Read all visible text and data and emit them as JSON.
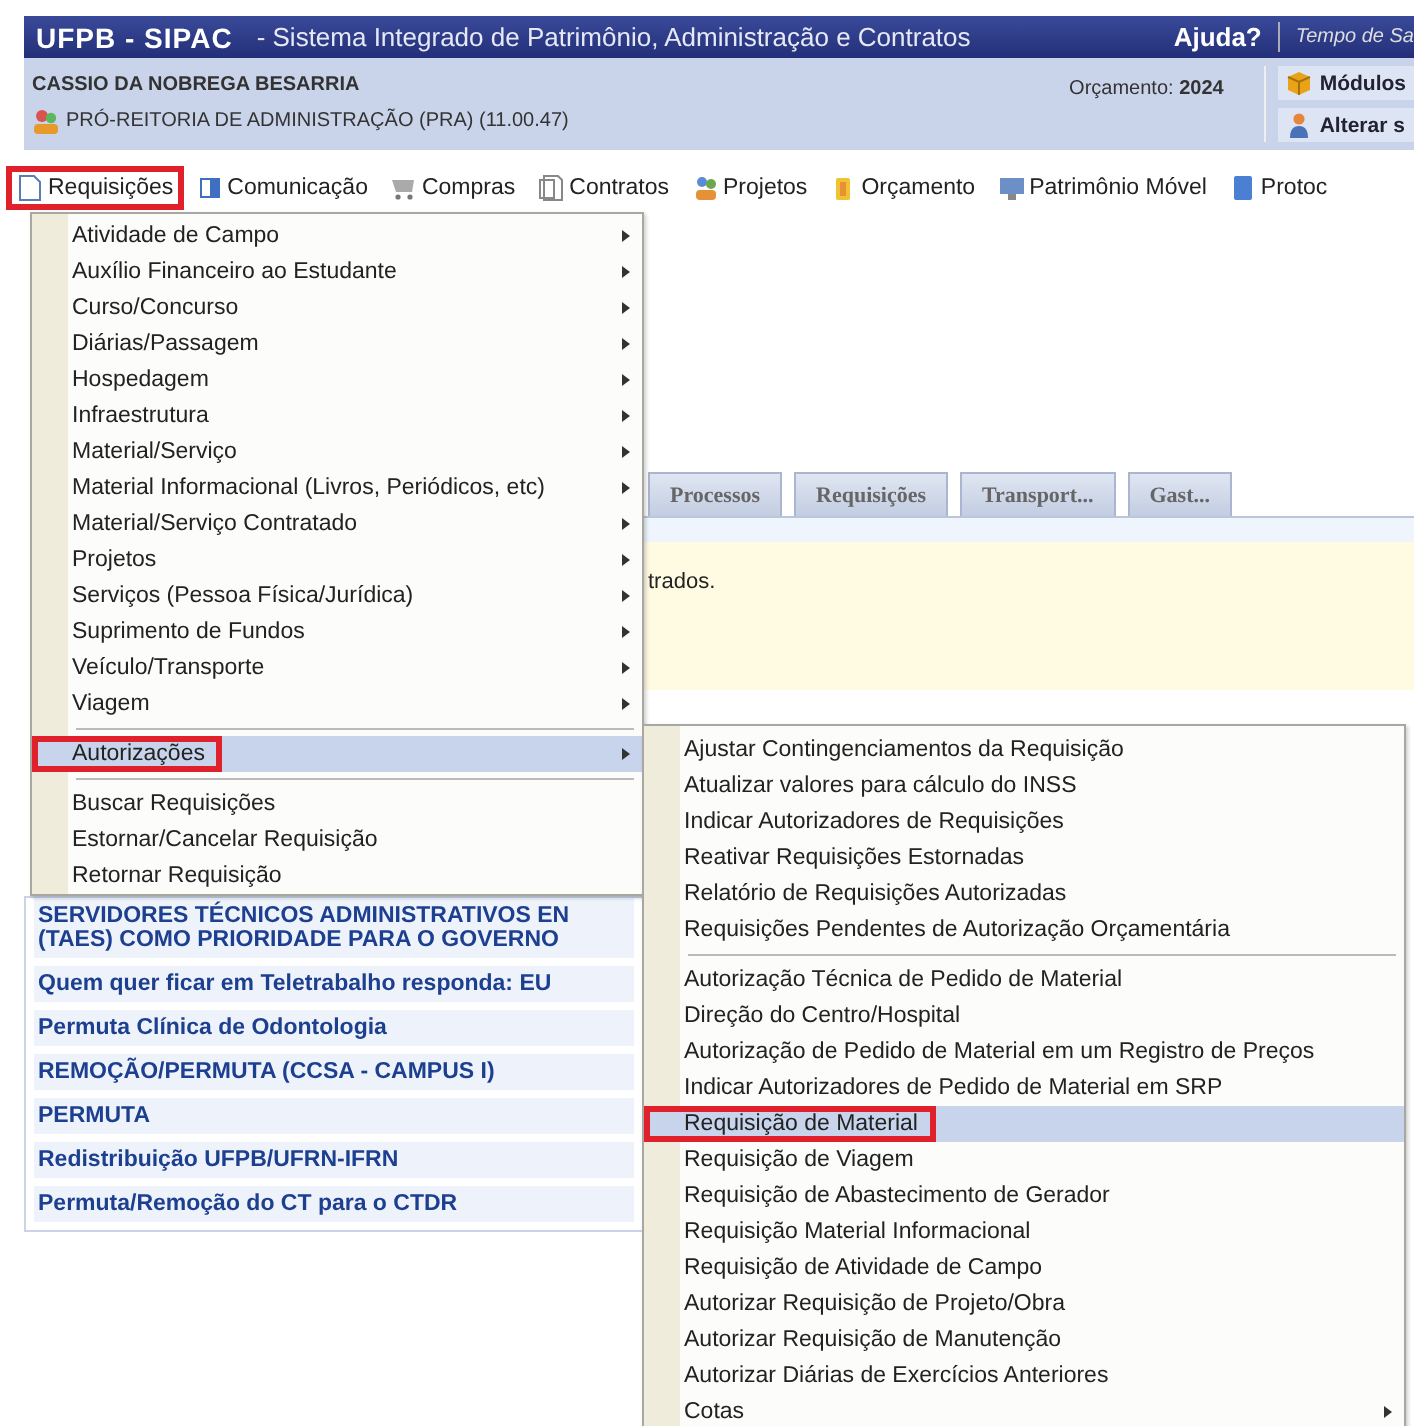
{
  "header": {
    "system": "UFPB - SIPAC",
    "title": "- Sistema Integrado de Patrimônio, Administração e Contratos",
    "help": "Ajuda?",
    "session": "Tempo de Sa"
  },
  "user": {
    "name": "CASSIO DA NOBREGA BESARRIA",
    "unit": "PRÓ-REITORIA DE ADMINISTRAÇÃO (PRA) (11.00.47)",
    "budget_label": "Orçamento:",
    "budget_year": "2024",
    "links": [
      {
        "label": "Módulos",
        "kind": "cube"
      },
      {
        "label": "Alterar s",
        "kind": "person"
      }
    ]
  },
  "menu_bar": [
    {
      "label": "Requisições",
      "kind": "page",
      "highlighted": true
    },
    {
      "label": "Comunicação",
      "kind": "book",
      "highlighted": false
    },
    {
      "label": "Compras",
      "kind": "cart",
      "highlighted": false
    },
    {
      "label": "Contratos",
      "kind": "document",
      "highlighted": false
    },
    {
      "label": "Projetos",
      "kind": "people",
      "highlighted": false
    },
    {
      "label": "Orçamento",
      "kind": "coins",
      "highlighted": false
    },
    {
      "label": "Patrimônio Móvel",
      "kind": "monitor",
      "highlighted": false
    },
    {
      "label": "Protoc",
      "kind": "binder",
      "highlighted": false
    }
  ],
  "dropdown": [
    [
      {
        "label": "Atividade de Campo",
        "submenu": true,
        "selected": false,
        "highlighted": false
      },
      {
        "label": "Auxílio Financeiro ao Estudante",
        "submenu": true,
        "selected": false,
        "highlighted": false
      },
      {
        "label": "Curso/Concurso",
        "submenu": true,
        "selected": false,
        "highlighted": false
      },
      {
        "label": "Diárias/Passagem",
        "submenu": true,
        "selected": false,
        "highlighted": false
      },
      {
        "label": "Hospedagem",
        "submenu": true,
        "selected": false,
        "highlighted": false
      },
      {
        "label": "Infraestrutura",
        "submenu": true,
        "selected": false,
        "highlighted": false
      },
      {
        "label": "Material/Serviço",
        "submenu": true,
        "selected": false,
        "highlighted": false
      },
      {
        "label": "Material Informacional (Livros, Periódicos, etc)",
        "submenu": true,
        "selected": false,
        "highlighted": false
      },
      {
        "label": "Material/Serviço Contratado",
        "submenu": true,
        "selected": false,
        "highlighted": false
      },
      {
        "label": "Projetos",
        "submenu": true,
        "selected": false,
        "highlighted": false
      },
      {
        "label": "Serviços (Pessoa Física/Jurídica)",
        "submenu": true,
        "selected": false,
        "highlighted": false
      },
      {
        "label": "Suprimento de Fundos",
        "submenu": true,
        "selected": false,
        "highlighted": false
      },
      {
        "label": "Veículo/Transporte",
        "submenu": true,
        "selected": false,
        "highlighted": false
      },
      {
        "label": "Viagem",
        "submenu": true,
        "selected": false,
        "highlighted": false
      }
    ],
    [
      {
        "label": "Autorizações",
        "submenu": true,
        "selected": true,
        "highlighted": true
      }
    ],
    [
      {
        "label": "Buscar Requisições",
        "submenu": false,
        "selected": false,
        "highlighted": false
      },
      {
        "label": "Estornar/Cancelar Requisição",
        "submenu": false,
        "selected": false,
        "highlighted": false
      },
      {
        "label": "Retornar Requisição",
        "submenu": false,
        "selected": false,
        "highlighted": false
      }
    ]
  ],
  "submenu": [
    [
      {
        "label": "Ajustar Contingenciamentos da Requisição",
        "submenu": false,
        "selected": false,
        "highlighted": false
      },
      {
        "label": "Atualizar valores para cálculo do INSS",
        "submenu": false,
        "selected": false,
        "highlighted": false
      },
      {
        "label": "Indicar Autorizadores de Requisições",
        "submenu": false,
        "selected": false,
        "highlighted": false
      },
      {
        "label": "Reativar Requisições Estornadas",
        "submenu": false,
        "selected": false,
        "highlighted": false
      },
      {
        "label": "Relatório de Requisições Autorizadas",
        "submenu": false,
        "selected": false,
        "highlighted": false
      },
      {
        "label": "Requisições Pendentes de Autorização Orçamentária",
        "submenu": false,
        "selected": false,
        "highlighted": false
      }
    ],
    [
      {
        "label": "Autorização Técnica de Pedido de Material",
        "submenu": false,
        "selected": false,
        "highlighted": false
      },
      {
        "label": "Direção do Centro/Hospital",
        "submenu": false,
        "selected": false,
        "highlighted": false
      },
      {
        "label": "Autorização de Pedido de Material em um Registro de Preços",
        "submenu": false,
        "selected": false,
        "highlighted": false
      },
      {
        "label": "Indicar Autorizadores de Pedido de Material em SRP",
        "submenu": false,
        "selected": false,
        "highlighted": false
      },
      {
        "label": "Requisição de Material",
        "submenu": false,
        "selected": true,
        "highlighted": true
      },
      {
        "label": "Requisição de Viagem",
        "submenu": false,
        "selected": false,
        "highlighted": false
      },
      {
        "label": "Requisição de Abastecimento de Gerador",
        "submenu": false,
        "selected": false,
        "highlighted": false
      },
      {
        "label": "Requisição Material Informacional",
        "submenu": false,
        "selected": false,
        "highlighted": false
      },
      {
        "label": "Requisição de Atividade de Campo",
        "submenu": false,
        "selected": false,
        "highlighted": false
      },
      {
        "label": "Autorizar Requisição de Projeto/Obra",
        "submenu": false,
        "selected": false,
        "highlighted": false
      },
      {
        "label": "Autorizar Requisição de Manutenção",
        "submenu": false,
        "selected": false,
        "highlighted": false
      },
      {
        "label": "Autorizar Diárias de Exercícios Anteriores",
        "submenu": false,
        "selected": false,
        "highlighted": false
      },
      {
        "label": "Cotas",
        "submenu": true,
        "selected": false,
        "highlighted": false
      }
    ]
  ],
  "tabs": [
    "Processos",
    "Requisições",
    "Transport...",
    "Gast..."
  ],
  "message": "trados.",
  "news": [
    {
      "lines": [
        "SERVIDORES TÉCNICOS ADMINISTRATIVOS EN",
        "(TAES) COMO PRIORIDADE PARA O GOVERNO"
      ]
    },
    {
      "lines": [
        "Quem quer ficar em Teletrabalho responda: EU"
      ]
    },
    {
      "lines": [
        "Permuta Clínica de Odontologia"
      ]
    },
    {
      "lines": [
        "REMOÇÃO/PERMUTA (CCSA - CAMPUS I)"
      ]
    },
    {
      "lines": [
        "PERMUTA"
      ]
    },
    {
      "lines": [
        "Redistribuição UFPB/UFRN-IFRN"
      ]
    },
    {
      "lines": [
        "Permuta/Remoção do CT para o CTDR"
      ]
    }
  ]
}
